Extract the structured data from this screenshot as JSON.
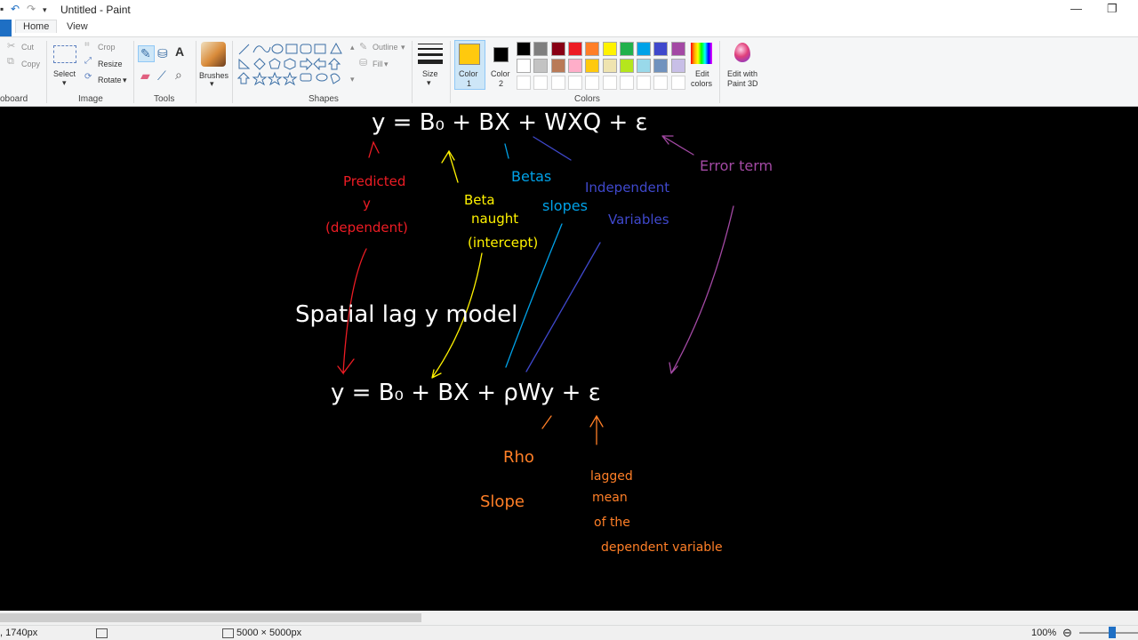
{
  "window": {
    "title": "Untitled - Paint"
  },
  "tabs": {
    "home": "Home",
    "view": "View"
  },
  "clipboard": {
    "cut": "Cut",
    "copy": "Copy",
    "group": "oboard"
  },
  "image": {
    "select": "Select",
    "crop": "Crop",
    "resize": "Resize",
    "rotate": "Rotate",
    "group": "Image"
  },
  "tools": {
    "group": "Tools"
  },
  "brushes": {
    "label": "Brushes"
  },
  "shapes": {
    "outline": "Outline",
    "fill": "Fill",
    "group": "Shapes"
  },
  "size": {
    "label": "Size"
  },
  "colors": {
    "color1_line1": "Color",
    "color1_line2": "1",
    "color2_line1": "Color",
    "color2_line2": "2",
    "edit_line1": "Edit",
    "edit_line2": "colors",
    "paint3d_line1": "Edit with",
    "paint3d_line2": "Paint 3D",
    "group": "Colors",
    "color1_value": "#ffc90e",
    "color2_value": "#000000",
    "palette_row1": [
      "#000000",
      "#7f7f7f",
      "#880015",
      "#ed1c24",
      "#ff7f27",
      "#fff200",
      "#22b14c",
      "#00a2e8",
      "#3f48cc",
      "#a349a4"
    ],
    "palette_row2": [
      "#ffffff",
      "#c3c3c3",
      "#b97a57",
      "#ffaec9",
      "#ffc90e",
      "#efe4b0",
      "#b5e61d",
      "#99d9ea",
      "#7092be",
      "#c8bfe7"
    ]
  },
  "canvas": {
    "eq1": "y = B₀ + BX + WXQ + ε",
    "predicted": "Predicted",
    "y": "y",
    "dependent": "(dependent)",
    "beta_naught_1": "Beta",
    "beta_naught_2": "naught",
    "intercept": "(intercept)",
    "betas": "Betas",
    "slopes": "slopes",
    "independent_1": "Independent",
    "independent_2": "Variables",
    "error_term": "Error term",
    "spatial_lag": "Spatial lag y model",
    "eq2": "y = B₀ + BX + ρWy + ε",
    "rho": "Rho",
    "slope": "Slope",
    "lagged_1": "lagged",
    "lagged_2": "mean",
    "lagged_3": "of  the",
    "lagged_4": "dependent variable"
  },
  "status": {
    "cursor": ", 1740px",
    "size": "5000 × 5000px",
    "zoom": "100%"
  }
}
